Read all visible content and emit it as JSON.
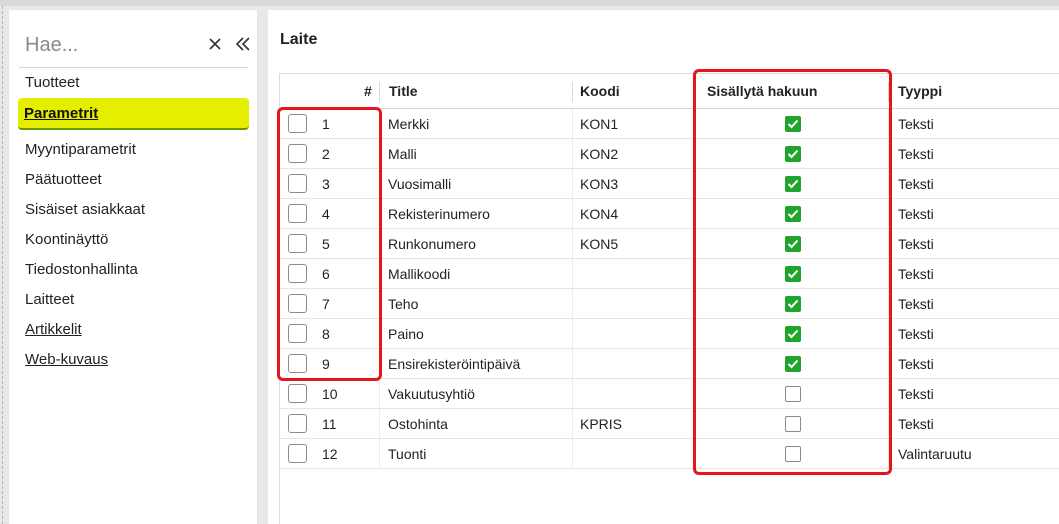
{
  "search": {
    "placeholder": "Hae..."
  },
  "sidebar": {
    "items": [
      {
        "label": "Tuotteet"
      },
      {
        "label": "Parametrit"
      },
      {
        "label": "Myyntiparametrit"
      },
      {
        "label": "Päätuotteet"
      },
      {
        "label": "Sisäiset asiakkaat"
      },
      {
        "label": "Koontinäyttö"
      },
      {
        "label": "Tiedostonhallinta"
      },
      {
        "label": "Laitteet"
      },
      {
        "label": "Artikkelit"
      },
      {
        "label": "Web-kuvaus"
      }
    ]
  },
  "main": {
    "title": "Laite"
  },
  "table": {
    "headers": {
      "num": "#",
      "title": "Title",
      "code": "Koodi",
      "include": "Sisällytä hakuun",
      "type": "Tyyppi"
    },
    "rows": [
      {
        "num": "1",
        "title": "Merkki",
        "code": "KON1",
        "included": true,
        "type": "Teksti"
      },
      {
        "num": "2",
        "title": "Malli",
        "code": "KON2",
        "included": true,
        "type": "Teksti"
      },
      {
        "num": "3",
        "title": "Vuosimalli",
        "code": "KON3",
        "included": true,
        "type": "Teksti"
      },
      {
        "num": "4",
        "title": "Rekisterinumero",
        "code": "KON4",
        "included": true,
        "type": "Teksti"
      },
      {
        "num": "5",
        "title": "Runkonumero",
        "code": "KON5",
        "included": true,
        "type": "Teksti"
      },
      {
        "num": "6",
        "title": "Mallikoodi",
        "code": "",
        "included": true,
        "type": "Teksti"
      },
      {
        "num": "7",
        "title": "Teho",
        "code": "",
        "included": true,
        "type": "Teksti"
      },
      {
        "num": "8",
        "title": "Paino",
        "code": "",
        "included": true,
        "type": "Teksti"
      },
      {
        "num": "9",
        "title": "Ensirekisteröintipäivä",
        "code": "",
        "included": true,
        "type": "Teksti"
      },
      {
        "num": "10",
        "title": "Vakuutusyhtiö",
        "code": "",
        "included": false,
        "type": "Teksti"
      },
      {
        "num": "11",
        "title": "Ostohinta",
        "code": "KPRIS",
        "included": false,
        "type": "Teksti"
      },
      {
        "num": "12",
        "title": "Tuonti",
        "code": "",
        "included": false,
        "type": "Valintaruutu"
      }
    ]
  },
  "colors": {
    "accent": "#e6ee00",
    "check_green": "#1fa52c",
    "highlight_red": "#e5151c"
  },
  "icons": {
    "close": "close-icon",
    "collapse": "double-chevron-left-icon",
    "check": "check-icon"
  }
}
